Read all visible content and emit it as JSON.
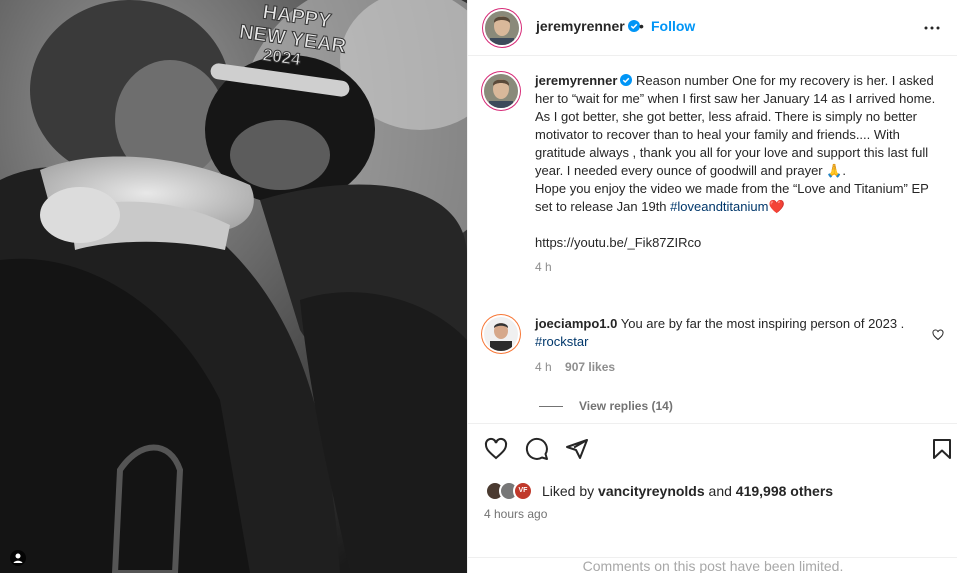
{
  "header": {
    "username": "jeremyrenner",
    "separator": "•",
    "follow_label": "Follow"
  },
  "caption": {
    "username": "jeremyrenner",
    "body_part1": "Reason number One for my recovery is her. I asked her to “wait for me” when I first saw her January 14 as I arrived home. As I got better, she got better, less afraid. There is simply no better motivator to recover than to heal your family and friends.... With gratitude always , thank you all for your love and support this last full year. I needed every ounce of goodwill and prayer 🙏.",
    "body_part2": "Hope you enjoy the video we made from the “Love and Titanium” EP set to release Jan 19th ",
    "hashtag": "#loveandtitanium",
    "emoji": "❤️",
    "url": "https://youtu.be/_Fik87ZIRco",
    "time": "4 h"
  },
  "photo": {
    "tiara_line1": "HAPPY",
    "tiara_line2": "NEW YEAR",
    "tiara_line3": "2024"
  },
  "comment": {
    "username": "joeciampo1.0",
    "text": " You are by far the most inspiring person of 2023 . ",
    "hashtag": "#rockstar",
    "time": "4 h",
    "likes": "907 likes",
    "view_replies": "View replies (14)"
  },
  "likes": {
    "prefix": "Liked by ",
    "user": "vancityreynolds",
    "conjunction": " and ",
    "count": "419,998 others",
    "mini_badge": "VF"
  },
  "post_time": "4 hours ago",
  "comments_limited": "Comments on this post have been limited.",
  "colors": {
    "accent": "#0095f6",
    "verified": "#0095f6",
    "text_secondary": "#737373",
    "heart": "#e0245e"
  },
  "icons": [
    "verified-badge-icon",
    "more-options-icon",
    "heart-icon",
    "comment-icon",
    "share-icon",
    "bookmark-icon",
    "user-tag-icon"
  ]
}
